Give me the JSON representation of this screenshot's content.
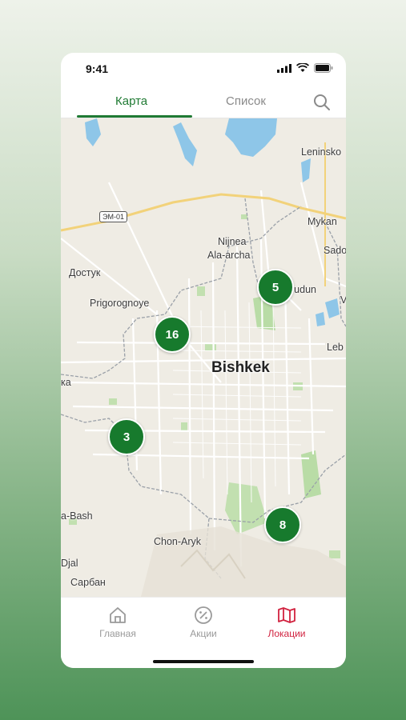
{
  "status_bar": {
    "time": "9:41"
  },
  "top_tabs": [
    {
      "label": "Карта",
      "active": true
    },
    {
      "label": "Список",
      "active": false
    }
  ],
  "map": {
    "city": "Bishkek",
    "labels": {
      "leninsko": "Leninsko",
      "mykan": "Mykan",
      "sado": "Sado",
      "nijnea": "Nijnea",
      "ala_archa": "Ala-archa",
      "dostuk": "Достук",
      "prigorognoye": "Prigorognoye",
      "rudun": "rudun",
      "v": "V",
      "leb": "Leb",
      "ka": "ка",
      "a_bash": "a-Bash",
      "chon_aryk": "Chon-Aryk",
      "djal": "Djal",
      "sarban": "Сарбан"
    },
    "road_sign": "ЭМ-01",
    "clusters": [
      {
        "id": "a",
        "count": "5"
      },
      {
        "id": "b",
        "count": "16"
      },
      {
        "id": "c",
        "count": "3"
      },
      {
        "id": "d",
        "count": "8"
      }
    ]
  },
  "tab_bar": [
    {
      "label": "Главная",
      "icon": "home-icon",
      "active": false
    },
    {
      "label": "Акции",
      "icon": "percent-icon",
      "active": false
    },
    {
      "label": "Локации",
      "icon": "map-icon",
      "active": true
    }
  ],
  "colors": {
    "accent_green": "#1f7a33",
    "cluster_green": "#177a2d",
    "active_red": "#d1223f"
  }
}
